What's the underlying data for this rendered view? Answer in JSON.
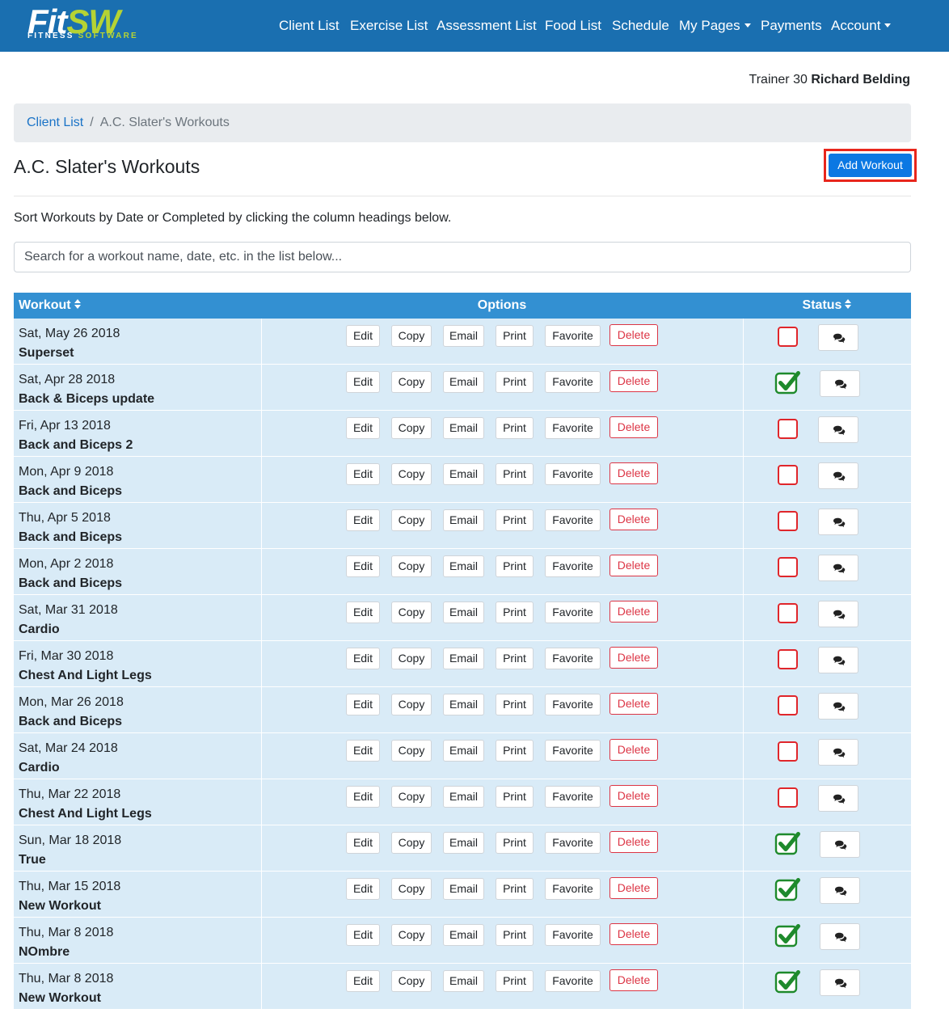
{
  "logo": {
    "main_a": "Fit",
    "main_b": "SW",
    "sub_a": "FITNESS ",
    "sub_b": "SOFTWARE"
  },
  "nav": [
    {
      "label": "Client List",
      "dropdown": false
    },
    {
      "label": "Exercise List",
      "dropdown": false
    },
    {
      "label": "Assessment List",
      "dropdown": false
    },
    {
      "label": "Food List",
      "dropdown": false
    },
    {
      "label": "Schedule",
      "dropdown": false
    },
    {
      "label": "My Pages",
      "dropdown": true
    },
    {
      "label": "Payments",
      "dropdown": false
    },
    {
      "label": "Account",
      "dropdown": true
    }
  ],
  "trainer": {
    "prefix": "Trainer 30",
    "name": "Richard Belding"
  },
  "breadcrumb": {
    "link": "Client List",
    "separator": "/",
    "current": "A.C. Slater's Workouts"
  },
  "page": {
    "title": "A.C. Slater's Workouts",
    "add_button": "Add Workout",
    "instructions": "Sort Workouts by Date or Completed by clicking the column headings below.",
    "search_placeholder": "Search for a workout name, date, etc. in the list below..."
  },
  "table": {
    "headers": {
      "workout": "Workout",
      "options": "Options",
      "status": "Status"
    },
    "buttons": {
      "edit": "Edit",
      "copy": "Copy",
      "email": "Email",
      "print": "Print",
      "favorite": "Favorite",
      "delete": "Delete"
    },
    "rows": [
      {
        "date": "Sat, May 26 2018",
        "name": "Superset",
        "completed": false
      },
      {
        "date": "Sat, Apr 28 2018",
        "name": "Back & Biceps update",
        "completed": true
      },
      {
        "date": "Fri, Apr 13 2018",
        "name": "Back and Biceps 2",
        "completed": false
      },
      {
        "date": "Mon, Apr 9 2018",
        "name": "Back and Biceps",
        "completed": false
      },
      {
        "date": "Thu, Apr 5 2018",
        "name": "Back and Biceps",
        "completed": false
      },
      {
        "date": "Mon, Apr 2 2018",
        "name": "Back and Biceps",
        "completed": false
      },
      {
        "date": "Sat, Mar 31 2018",
        "name": "Cardio",
        "completed": false
      },
      {
        "date": "Fri, Mar 30 2018",
        "name": "Chest And Light Legs",
        "completed": false
      },
      {
        "date": "Mon, Mar 26 2018",
        "name": "Back and Biceps",
        "completed": false
      },
      {
        "date": "Sat, Mar 24 2018",
        "name": "Cardio",
        "completed": false
      },
      {
        "date": "Thu, Mar 22 2018",
        "name": "Chest And Light Legs",
        "completed": false
      },
      {
        "date": "Sun, Mar 18 2018",
        "name": "True",
        "completed": true
      },
      {
        "date": "Thu, Mar 15 2018",
        "name": "New Workout",
        "completed": true
      },
      {
        "date": "Thu, Mar 8 2018",
        "name": "NOmbre",
        "completed": true
      },
      {
        "date": "Thu, Mar 8 2018",
        "name": "New Workout",
        "completed": true
      }
    ]
  },
  "colors": {
    "navbar": "#1a6fb0",
    "accent_green": "#b5d334",
    "table_header": "#3390d2",
    "row_bg": "#d9ebf7",
    "primary_button": "#0b78e3",
    "danger": "#dc3545",
    "check_green": "#1e8a2c",
    "highlight_frame": "#e8261c"
  },
  "icons": {
    "comment": "comments-icon",
    "checked": "checkbox-checked-icon",
    "unchecked": "checkbox-empty-icon",
    "sort": "sort-icon",
    "dropdown": "caret-down-icon"
  }
}
